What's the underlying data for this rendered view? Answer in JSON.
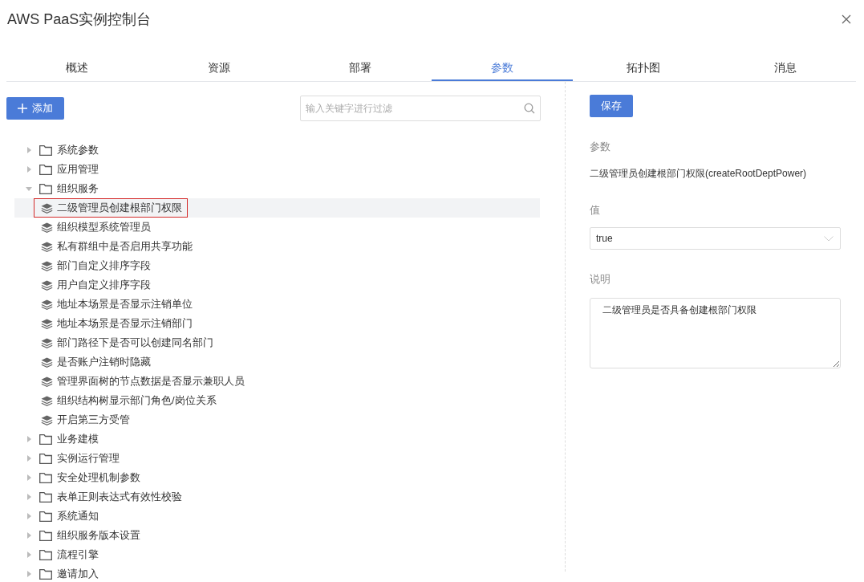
{
  "window": {
    "title": "AWS PaaS实例控制台"
  },
  "tabs": [
    {
      "label": "概述",
      "selected": false
    },
    {
      "label": "资源",
      "selected": false
    },
    {
      "label": "部署",
      "selected": false
    },
    {
      "label": "参数",
      "selected": true
    },
    {
      "label": "拓扑图",
      "selected": false
    },
    {
      "label": "消息",
      "selected": false
    }
  ],
  "add_button": "添加",
  "filter": {
    "placeholder": "输入关键字进行过滤"
  },
  "tree": [
    {
      "label": "系统参数",
      "expanded": false
    },
    {
      "label": "应用管理",
      "expanded": false
    },
    {
      "label": "组织服务",
      "expanded": true,
      "children": [
        {
          "label": "二级管理员创建根部门权限",
          "selected": true
        },
        {
          "label": "组织模型系统管理员",
          "selected": false
        },
        {
          "label": "私有群组中是否启用共享功能",
          "selected": false
        },
        {
          "label": "部门自定义排序字段",
          "selected": false
        },
        {
          "label": "用户自定义排序字段",
          "selected": false
        },
        {
          "label": "地址本场景是否显示注销单位",
          "selected": false
        },
        {
          "label": "地址本场景是否显示注销部门",
          "selected": false
        },
        {
          "label": "部门路径下是否可以创建同名部门",
          "selected": false
        },
        {
          "label": "是否账户注销时隐藏",
          "selected": false
        },
        {
          "label": "管理界面树的节点数据是否显示兼职人员",
          "selected": false
        },
        {
          "label": "组织结构树显示部门角色/岗位关系",
          "selected": false
        },
        {
          "label": "开启第三方受管",
          "selected": false
        }
      ]
    },
    {
      "label": "业务建模",
      "expanded": false
    },
    {
      "label": "实例运行管理",
      "expanded": false
    },
    {
      "label": "安全处理机制参数",
      "expanded": false
    },
    {
      "label": "表单正则表达式有效性校验",
      "expanded": false
    },
    {
      "label": "系统通知",
      "expanded": false
    },
    {
      "label": "组织服务版本设置",
      "expanded": false
    },
    {
      "label": "流程引擎",
      "expanded": false
    },
    {
      "label": "邀请加入",
      "expanded": false
    }
  ],
  "detail": {
    "save_button": "保存",
    "param_label": "参数",
    "param_value": "二级管理员创建根部门权限(createRootDeptPower)",
    "value_label": "值",
    "value": "true",
    "description_label": "说明",
    "description": "二级管理员是否具备创建根部门权限"
  }
}
